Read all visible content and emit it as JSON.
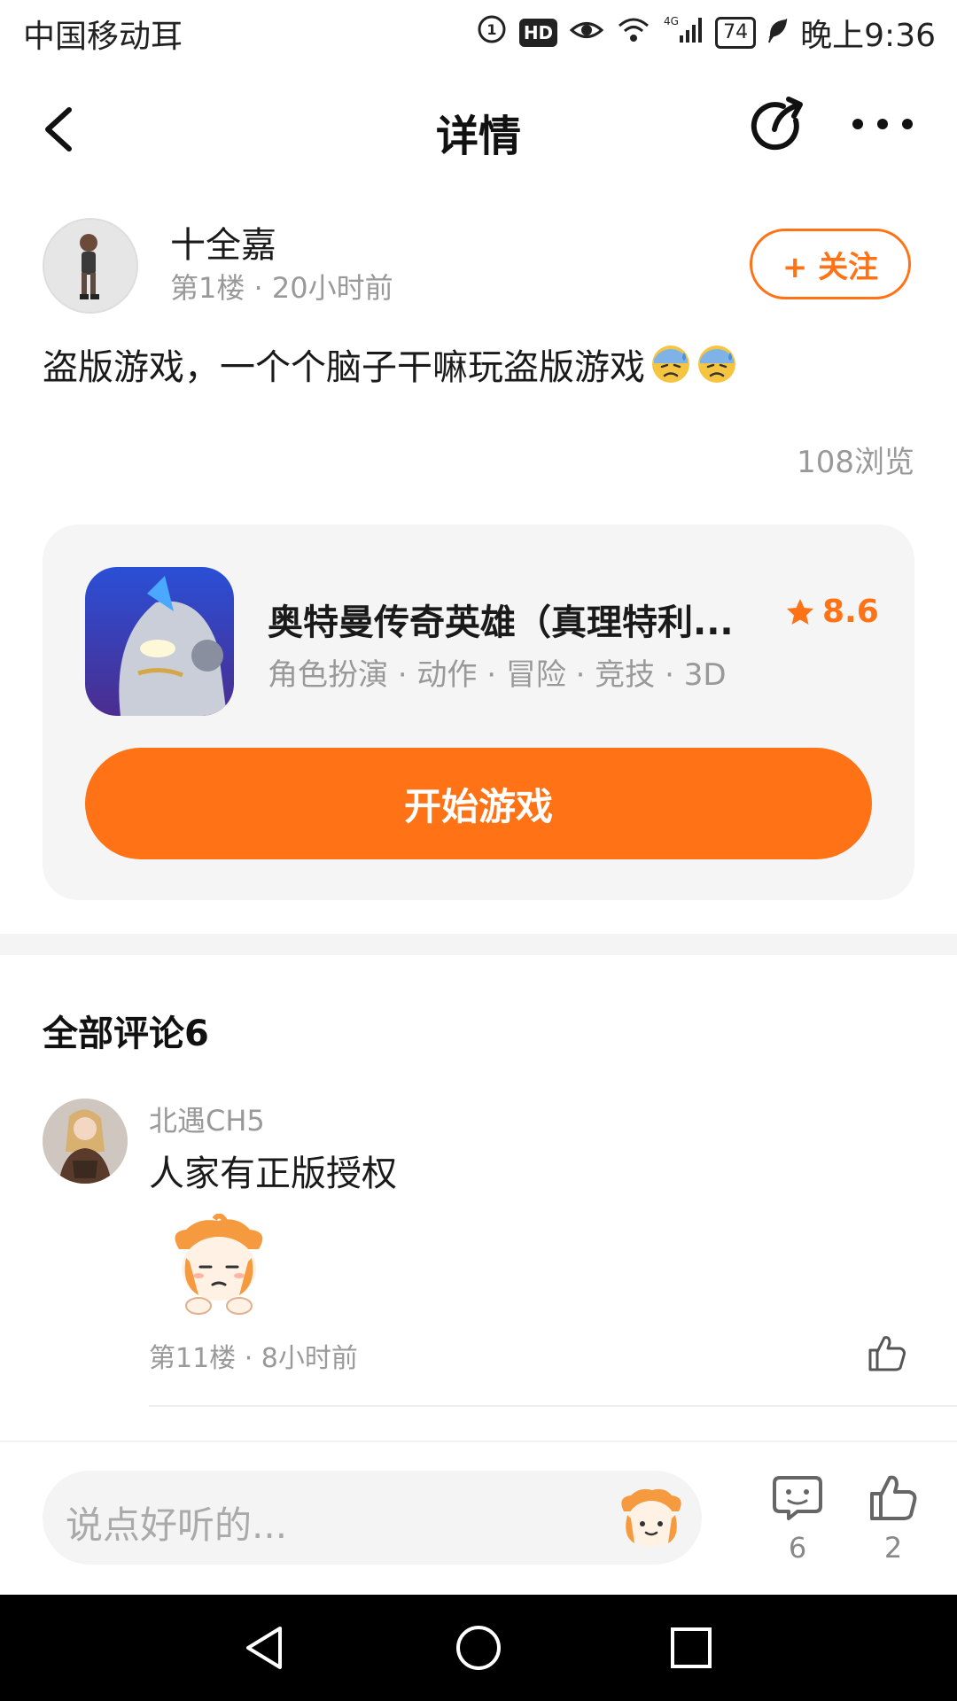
{
  "status_bar": {
    "carrier": "中国移动",
    "hd": "HD",
    "network": "4G",
    "battery": "74",
    "time": "晚上9:36"
  },
  "nav": {
    "title": "详情"
  },
  "post": {
    "author": "十全嘉",
    "meta": "第1楼 · 20小时前",
    "follow_label": "+ 关注",
    "text": "盗版游戏，一个个脑子干嘛玩盗版游戏",
    "views": "108浏览"
  },
  "game": {
    "name": "奥特曼传奇英雄（真理特利...",
    "rating": "8.6",
    "tags": "角色扮演 · 动作 · 冒险 · 竞技 · 3D",
    "play_label": "开始游戏"
  },
  "comments": {
    "title": "全部评论6",
    "items": [
      {
        "user": "北遇CH5",
        "text": "人家有正版授权",
        "meta": "第11楼 · 8小时前"
      }
    ]
  },
  "reply_bar": {
    "placeholder": "说点好听的...",
    "comment_count": "6",
    "like_count": "2"
  },
  "colors": {
    "accent": "#ff7215",
    "muted_text": "#999999",
    "card_bg": "#f5f5f5"
  }
}
